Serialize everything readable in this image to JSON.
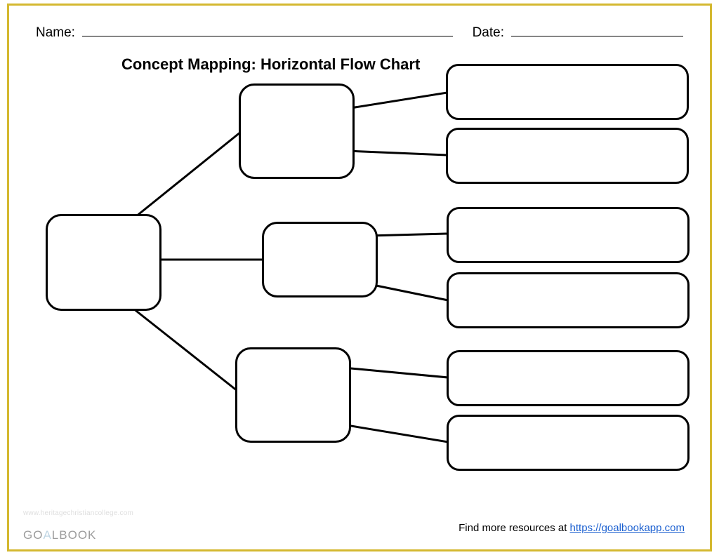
{
  "header": {
    "name_label": "Name:",
    "date_label": "Date:"
  },
  "title": "Concept Mapping: Horizontal Flow Chart",
  "watermark": "www.heritagechristiancollege.com",
  "logo": {
    "part1": "GO",
    "accent": "A",
    "part2": "LBOOK"
  },
  "footer": {
    "prefix": "Find more resources at ",
    "link_text": "https://goalbookapp.com"
  },
  "diagram": {
    "root": "",
    "middle": [
      "",
      "",
      ""
    ],
    "leaves": [
      "",
      "",
      "",
      "",
      "",
      ""
    ]
  }
}
